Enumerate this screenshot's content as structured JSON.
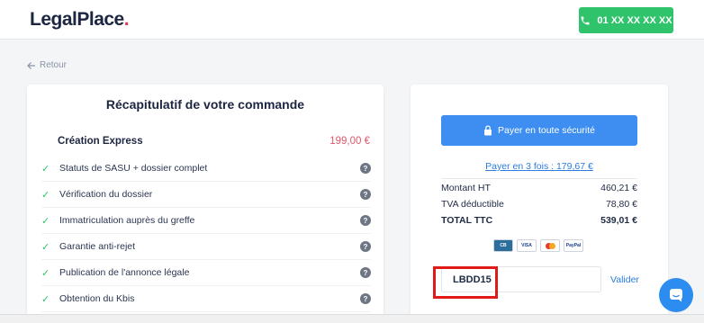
{
  "header": {
    "logo_text": "LegalPlace",
    "logo_dot": ".",
    "phone_label": "01 XX XX XX XX",
    "phone_icon": "phone-icon",
    "brand_green": "#2fc46b"
  },
  "nav": {
    "back_label": "Retour",
    "back_icon": "arrow-left-icon"
  },
  "summary": {
    "title": "Récapitulatif de votre commande",
    "product_name": "Création Express",
    "product_price": "199,00 €",
    "features": [
      {
        "label": "Statuts de SASU + dossier complet"
      },
      {
        "label": "Vérification du dossier"
      },
      {
        "label": "Immatriculation auprès du greffe"
      },
      {
        "label": "Garantie anti-rejet"
      },
      {
        "label": "Publication de l'annonce légale"
      },
      {
        "label": "Obtention du Kbis"
      }
    ],
    "help_glyph": "?",
    "check_glyph": "✓"
  },
  "payment": {
    "pay_button_label": "Payer en toute sécurité",
    "pay_button_icon": "lock-icon",
    "installments_link": "Payer en 3 fois : 179,67 €",
    "lines": [
      {
        "label": "Montant HT",
        "value": "460,21 €"
      },
      {
        "label": "TVA déductible",
        "value": "78,80 €"
      },
      {
        "label": "TOTAL TTC",
        "value": "539,01 €"
      }
    ],
    "card_logos": [
      {
        "name": "cb-card-icon",
        "text": "CB"
      },
      {
        "name": "visa-card-icon",
        "text": "VISA"
      },
      {
        "name": "mastercard-icon",
        "text": ""
      },
      {
        "name": "paypal-icon",
        "text": "PayPal"
      }
    ],
    "coupon_value": "LBDD15",
    "validate_label": "Valider",
    "accent": "#3d8ef0"
  }
}
